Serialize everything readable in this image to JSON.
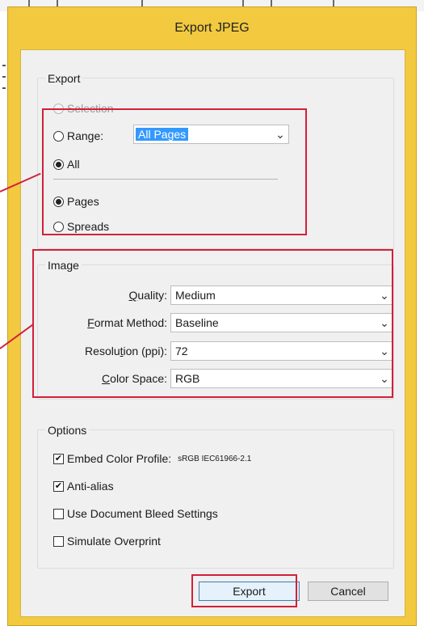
{
  "dialog": {
    "title": "Export JPEG"
  },
  "export_group": {
    "label": "Export",
    "selection_label": "Selection",
    "range_label": "Range:",
    "range_value": "All Pages",
    "all_label": "All",
    "pages_label": "Pages",
    "spreads_label": "Spreads"
  },
  "image_group": {
    "label": "Image",
    "quality": {
      "label_u": "Q",
      "label_rest": "uality:",
      "value": "Medium"
    },
    "format": {
      "label_u": "F",
      "label_rest": "ormat Method:",
      "value": "Baseline"
    },
    "resolution": {
      "label_pre": "Resolu",
      "label_u": "t",
      "label_rest": "ion (ppi):",
      "value": "72"
    },
    "colorspace": {
      "label_u": "C",
      "label_rest": "olor Space:",
      "value": "RGB"
    }
  },
  "options_group": {
    "label": "Options",
    "embed_label": "Embed Color Profile:",
    "embed_profile": "sRGB IEC61966-2.1",
    "antialias_label": "Anti-alias",
    "bleed_label": "Use Document Bleed Settings",
    "overprint_label": "Simulate Overprint"
  },
  "buttons": {
    "export": "Export",
    "cancel": "Cancel"
  },
  "state": {
    "range_selected": false,
    "all_selected": true,
    "pages_selected": true,
    "spreads_selected": false,
    "embed_checked": true,
    "antialias_checked": true,
    "bleed_checked": false,
    "overprint_checked": false
  },
  "colors": {
    "dialog_frame": "#f2c93f",
    "highlight_box": "#d0213a",
    "selection_blue": "#3399ff"
  }
}
